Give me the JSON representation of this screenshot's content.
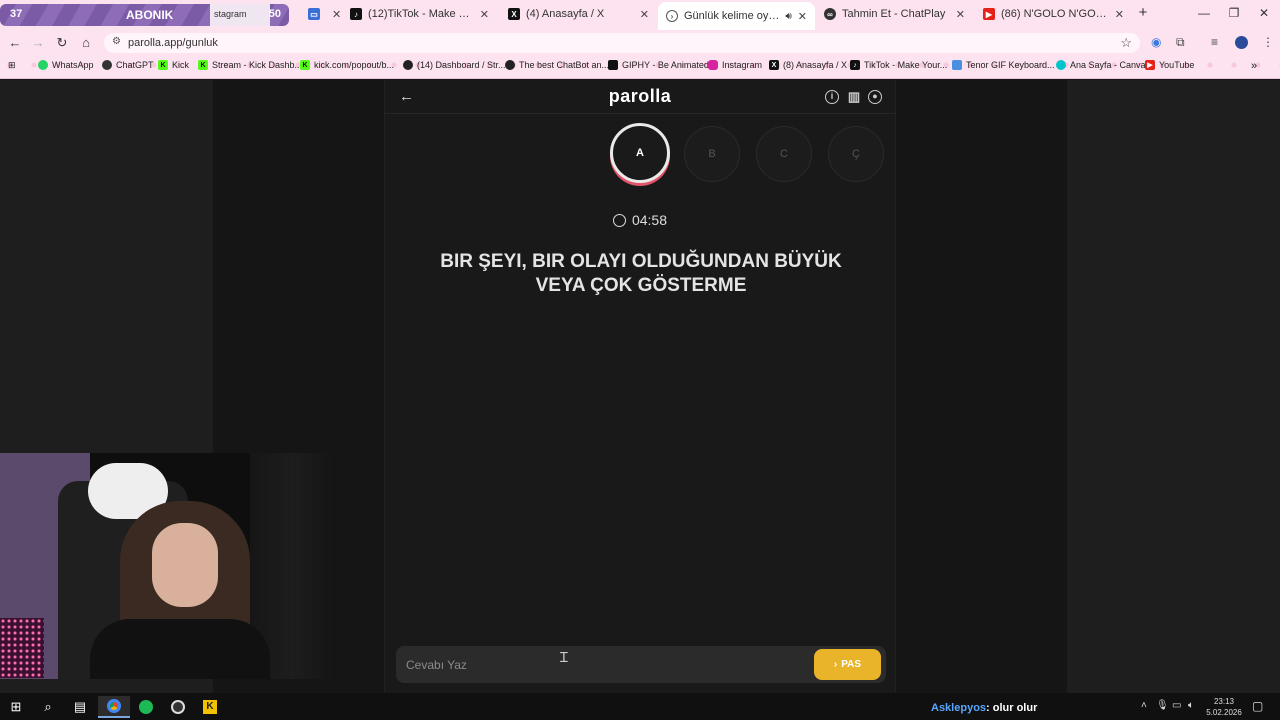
{
  "overlay": {
    "count_left": "37",
    "label": "ABONIK",
    "count_right": "50",
    "peek_tab": "stagram"
  },
  "tabs": [
    {
      "title": "(12)TikTok - Make Your Day",
      "icon": "tiktok-icon",
      "color": "#111111"
    },
    {
      "title": "(4) Anasayfa / X",
      "icon": "x-icon",
      "color": "#111111"
    },
    {
      "title": "Günlük kelime oyunu - parolla",
      "icon": "parolla-icon",
      "color": "#444444",
      "active": true
    },
    {
      "title": "Tahmin Et - ChatPlay",
      "icon": "chatplay-icon",
      "color": "#222222"
    },
    {
      "title": "(86) N'GOLO N'GOLO KANTE",
      "icon": "youtube-icon",
      "color": "#e62117"
    }
  ],
  "address_bar": {
    "url": "parolla.app/gunluk"
  },
  "bookmarks": [
    {
      "label": "WhatsApp",
      "icon": "whatsapp-icon",
      "color": "#25d366"
    },
    {
      "label": "ChatGPT",
      "icon": "chatgpt-icon",
      "color": "#333333"
    },
    {
      "label": "Kick",
      "icon": "kick-icon",
      "color": "#53fc18"
    },
    {
      "label": "Stream - Kick Dashb...",
      "icon": "kick-icon",
      "color": "#53fc18"
    },
    {
      "label": "kick.com/popout/b...",
      "icon": "kick-icon",
      "color": "#53fc18"
    },
    {
      "label": "(14) Dashboard / Str...",
      "icon": "dashboard-icon",
      "color": "#222222"
    },
    {
      "label": "The best ChatBot an...",
      "icon": "chatbot-icon",
      "color": "#222222"
    },
    {
      "label": "GIPHY - Be Animated",
      "icon": "giphy-icon",
      "color": "#111111"
    },
    {
      "label": "Instagram",
      "icon": "instagram-icon",
      "color": "#d6249f"
    },
    {
      "label": "(8) Anasayfa / X",
      "icon": "x-icon",
      "color": "#111111"
    },
    {
      "label": "TikTok - Make Your...",
      "icon": "tiktok-icon",
      "color": "#111111"
    },
    {
      "label": "Tenor GIF Keyboard...",
      "icon": "tenor-icon",
      "color": "#4a90e2"
    },
    {
      "label": "Ana Sayfa - Canva",
      "icon": "canva-icon",
      "color": "#00c4cc"
    },
    {
      "label": "YouTube",
      "icon": "youtube-icon",
      "color": "#e62117"
    }
  ],
  "game": {
    "logo": "parolla",
    "letters": [
      {
        "char": "A",
        "state": "current"
      },
      {
        "char": "B",
        "state": "pending"
      },
      {
        "char": "C",
        "state": "pending"
      },
      {
        "char": "Ç",
        "state": "pending"
      }
    ],
    "timer": "04:58",
    "clue": "Bir şeyi, bir olayı olduğundan büyük veya çok gösterme",
    "answer_placeholder": "Cevabı Yaz",
    "pass_label": "PAS"
  },
  "taskbar": {
    "chat_user": "Asklepyos",
    "chat_message": ": olur olur",
    "time": "23:13",
    "date": "5.02.2026"
  }
}
